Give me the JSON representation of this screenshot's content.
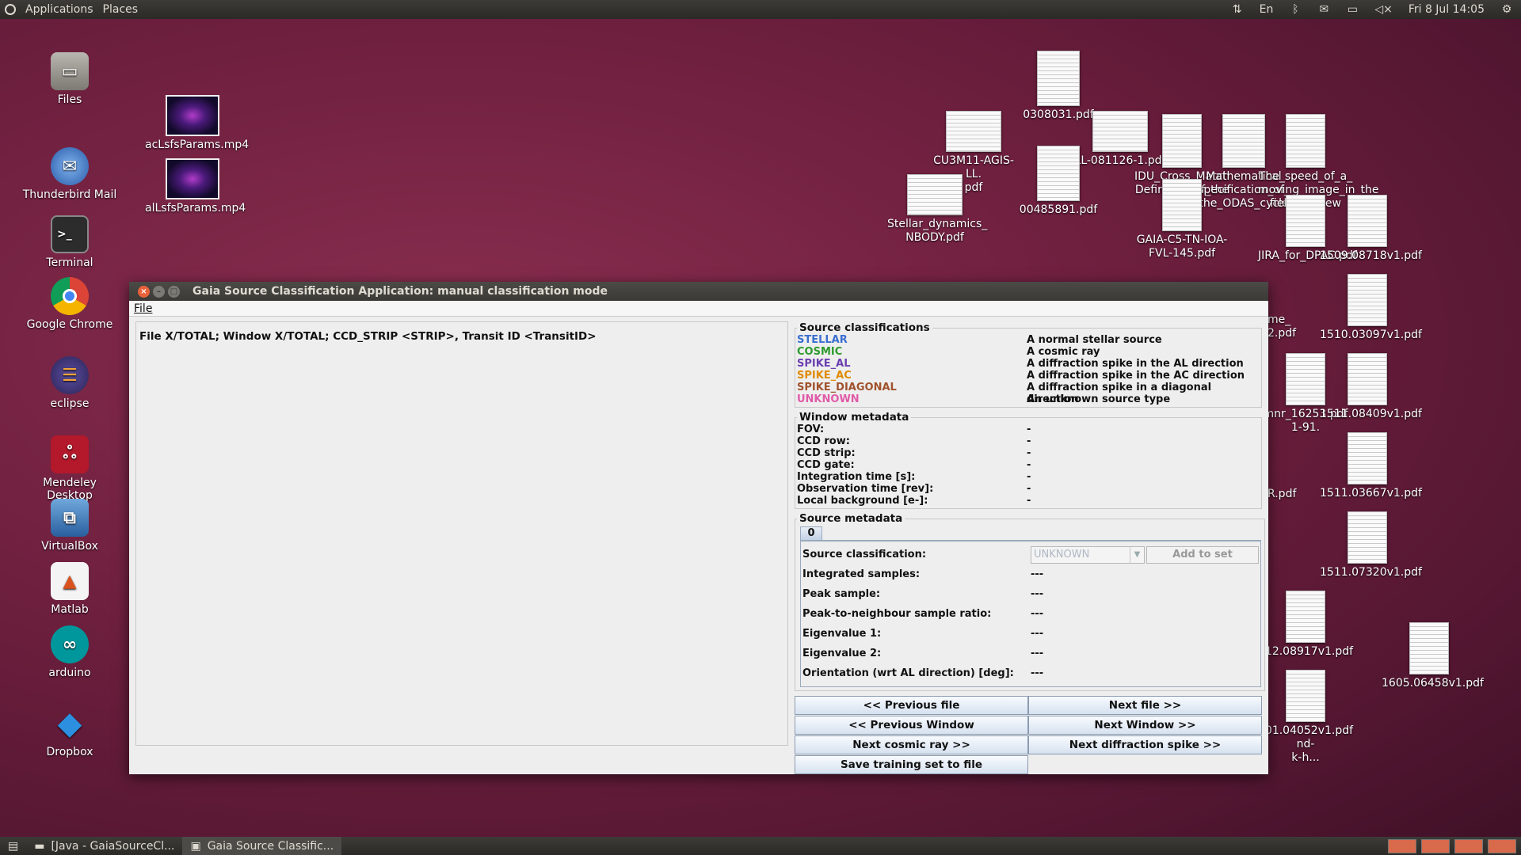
{
  "top_panel": {
    "applications": "Applications",
    "places": "Places",
    "keyboard": "En",
    "datetime": "Fri 8 Jul 14:05"
  },
  "launcher": [
    {
      "label": "Files",
      "icon": "files-icon"
    },
    {
      "label": "Thunderbird Mail",
      "icon": "thunderbird-icon"
    },
    {
      "label": "Terminal",
      "icon": "terminal-icon"
    },
    {
      "label": "Google Chrome",
      "icon": "chrome-icon"
    },
    {
      "label": "eclipse",
      "icon": "eclipse-icon"
    },
    {
      "label": "Mendeley Desktop",
      "icon": "mendeley-icon"
    },
    {
      "label": "VirtualBox",
      "icon": "virtualbox-icon"
    },
    {
      "label": "Matlab",
      "icon": "matlab-icon"
    },
    {
      "label": "arduino",
      "icon": "arduino-icon"
    },
    {
      "label": "Dropbox",
      "icon": "dropbox-icon"
    }
  ],
  "desktop_files": {
    "video1": "acLsfsParams.mp4",
    "video2": "alLsfsParams.mp4",
    "f0308031": "0308031.pdf",
    "cu3m11": "CU3M11-AGIS-LL.\npdf",
    "ll081126": "LL-081126-1.pdf",
    "f00485891": "00485891.pdf",
    "stellar": "Stellar_dynamics_\nNBODY.pdf",
    "idu": "IDU_Cross_Match\nDefinition_of_the",
    "mathematical": "Mathematical\nspecification_of_\nthe_ODAS_cycle",
    "speed": "The_speed_of_a_\nmoving_image_in_the\nfield_of_view",
    "gaia_c5": "GAIA-C5-TN-IOA-\nFVL-145.pdf",
    "jira": "JIRA_for_DPAC.pdf",
    "f1509": "1509.08718v1.pdf",
    "f1510": "1510.03097v1.pdf",
    "f1511_08409": "1511.08409v1.pdf",
    "mnr": "mnr_16253.pdf\n1-91.",
    "me": "me_\n2.pdf",
    "r_pdf": "R.pdf",
    "f1511_03667": "1511.03667v1.pdf",
    "f1511_07320": "1511.07320v1.pdf",
    "f1512": "512.08917v1.pdf",
    "f1605": "1605.06458v1.pdf",
    "f1601": "601.04052v1.pdf\nnd-\nk-h..."
  },
  "window": {
    "title": "Gaia Source Classification Application: manual classification mode",
    "menu_file": "File",
    "left_header": "File X/TOTAL; Window X/TOTAL; CCD_STRIP <STRIP>, Transit ID <TransitID>",
    "source_classifications": {
      "legend": "Source classifications",
      "items": [
        {
          "name": "STELLAR",
          "desc": "A normal stellar source",
          "color": "#3a6fd0"
        },
        {
          "name": "COSMIC",
          "desc": "A cosmic ray",
          "color": "#2e9a2e"
        },
        {
          "name": "SPIKE_AL",
          "desc": "A diffraction spike in the AL direction",
          "color": "#6a3fb0"
        },
        {
          "name": "SPIKE_AC",
          "desc": "A diffraction spike in the AC direction",
          "color": "#e08a00"
        },
        {
          "name": "SPIKE_DIAGONAL",
          "desc": "A diffraction spike in a diagonal direction",
          "color": "#a0522d"
        },
        {
          "name": "UNKNOWN",
          "desc": "An unknown source type",
          "color": "#e05aa8"
        }
      ]
    },
    "window_metadata": {
      "legend": "Window metadata",
      "rows": [
        {
          "k": "FOV:",
          "v": "-"
        },
        {
          "k": "CCD row:",
          "v": "-"
        },
        {
          "k": "CCD strip:",
          "v": "-"
        },
        {
          "k": "CCD gate:",
          "v": "-"
        },
        {
          "k": "Integration time [s]:",
          "v": "-"
        },
        {
          "k": "Observation time [rev]:",
          "v": "-"
        },
        {
          "k": "Local background [e-]:",
          "v": "-"
        }
      ]
    },
    "source_metadata": {
      "legend": "Source metadata",
      "tab": "0",
      "classification_label": "Source classification:",
      "classification_value": "UNKNOWN",
      "add_to_set": "Add to set",
      "rows": [
        {
          "k": "Integrated samples:",
          "v": "---"
        },
        {
          "k": "Peak sample:",
          "v": "---"
        },
        {
          "k": "Peak-to-neighbour sample ratio:",
          "v": "---"
        },
        {
          "k": "Eigenvalue 1:",
          "v": "---"
        },
        {
          "k": "Eigenvalue 2:",
          "v": "---"
        },
        {
          "k": "Orientation (wrt AL direction) [deg]:",
          "v": "---"
        }
      ]
    },
    "buttons": {
      "prev_file": "<< Previous file",
      "next_file": "Next file >>",
      "prev_window": "<< Previous Window",
      "next_window": "Next Window >>",
      "next_cosmic": "Next cosmic ray >>",
      "next_spike": "Next diffraction spike >>",
      "save": "Save training set to file"
    }
  },
  "taskbar": {
    "task1": "[Java - GaiaSourceCl...",
    "task2": "Gaia Source Classific..."
  }
}
